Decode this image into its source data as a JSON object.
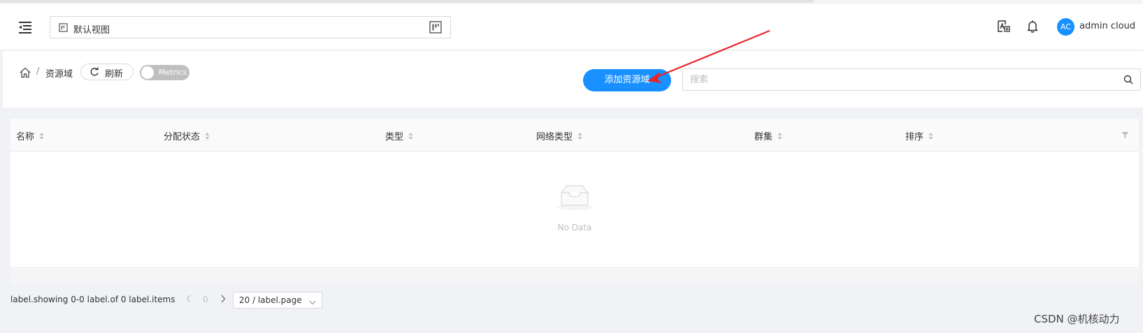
{
  "header": {
    "view_selector": {
      "text": "默认视图"
    },
    "user": {
      "avatar_initials": "AC",
      "name": "admin cloud"
    }
  },
  "toolbar": {
    "breadcrumb": {
      "separator": "/",
      "current": "资源域"
    },
    "refresh_label": "刷新",
    "metrics_toggle": {
      "label": "Metrics",
      "state": "off"
    },
    "add_button_label": "添加资源域",
    "search": {
      "placeholder": "搜索",
      "value": ""
    }
  },
  "table": {
    "columns": [
      {
        "label": "名称",
        "sortable": true
      },
      {
        "label": "分配状态",
        "sortable": true
      },
      {
        "label": "类型",
        "sortable": true
      },
      {
        "label": "网络类型",
        "sortable": true
      },
      {
        "label": "群集",
        "sortable": true
      },
      {
        "label": "排序",
        "sortable": true
      }
    ],
    "rows": [],
    "empty_text": "No Data"
  },
  "pagination": {
    "total_text": "label.showing 0-0 label.of 0 label.items",
    "current_page": "0",
    "page_size": "20 / label.page"
  },
  "watermark": "CSDN @机核动力",
  "colors": {
    "primary": "#1890ff",
    "annotation_arrow": "#e8262a"
  }
}
